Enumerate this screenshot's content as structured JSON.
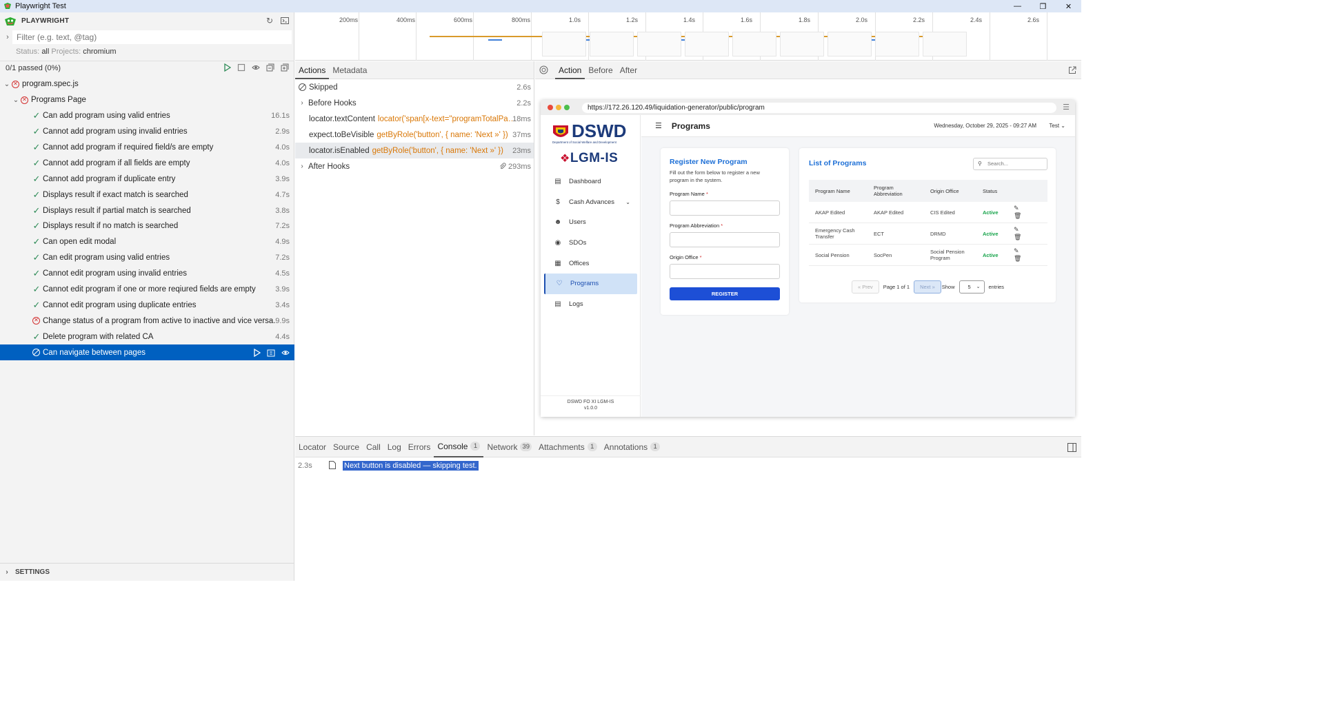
{
  "window": {
    "title": "Playwright Test",
    "controls": [
      "minimize-icon",
      "restore-icon",
      "close-icon"
    ]
  },
  "sidebar": {
    "brand": "PLAYWRIGHT",
    "filter_placeholder": "Filter (e.g. text, @tag)",
    "status_label": "Status:",
    "status_value": "all",
    "projects_label": "Projects:",
    "projects_value": "chromium",
    "summary": "0/1 passed (0%)",
    "file": "program.spec.js",
    "suite": "Programs Page",
    "tests": [
      {
        "name": "Can add program using valid entries",
        "duration": "16.1s",
        "status": "passed"
      },
      {
        "name": "Cannot add program using invalid entries",
        "duration": "2.9s",
        "status": "passed"
      },
      {
        "name": "Cannot add program if required field/s are empty",
        "duration": "4.0s",
        "status": "passed"
      },
      {
        "name": "Cannot add program if all fields are empty",
        "duration": "4.0s",
        "status": "passed"
      },
      {
        "name": "Cannot add program if duplicate entry",
        "duration": "3.9s",
        "status": "passed"
      },
      {
        "name": "Displays result if exact match is searched",
        "duration": "4.7s",
        "status": "passed"
      },
      {
        "name": "Displays result if partial match is searched",
        "duration": "3.8s",
        "status": "passed"
      },
      {
        "name": "Displays result if no match is searched",
        "duration": "7.2s",
        "status": "passed"
      },
      {
        "name": "Can open edit modal",
        "duration": "4.9s",
        "status": "passed"
      },
      {
        "name": "Can edit program using valid entries",
        "duration": "7.2s",
        "status": "passed"
      },
      {
        "name": "Cannot edit program using invalid entries",
        "duration": "4.5s",
        "status": "passed"
      },
      {
        "name": "Cannot edit program if one or more reqiured fields are empty",
        "duration": "3.9s",
        "status": "passed"
      },
      {
        "name": "Cannot edit program using duplicate entries",
        "duration": "3.4s",
        "status": "passed"
      },
      {
        "name": "Change status of a program from active to inactive and vice versa.",
        "duration": "9.9s",
        "status": "failed"
      },
      {
        "name": "Delete program with related CA",
        "duration": "4.4s",
        "status": "passed"
      },
      {
        "name": "Can navigate between pages",
        "duration": "",
        "status": "skipped"
      }
    ],
    "settings": "SETTINGS"
  },
  "timeline": {
    "ticks": [
      "200ms",
      "400ms",
      "600ms",
      "800ms",
      "1.0s",
      "1.2s",
      "1.4s",
      "1.6s",
      "1.8s",
      "2.0s",
      "2.2s",
      "2.4s",
      "2.6s"
    ]
  },
  "actions": {
    "tabs": [
      "Actions",
      "Metadata"
    ],
    "rows": [
      {
        "label": "Skipped",
        "locator": "",
        "duration": "2.6s"
      },
      {
        "label": "Before Hooks",
        "locator": "",
        "duration": "2.2s"
      },
      {
        "label": "locator.textContent",
        "locator": "locator('span[x-text=\"programTotalPages...",
        "duration": "18ms"
      },
      {
        "label": "expect.toBeVisible",
        "locator": "getByRole('button', { name: 'Next »' })",
        "duration": "37ms"
      },
      {
        "label": "locator.isEnabled",
        "locator": "getByRole('button', { name: 'Next »' })",
        "duration": "23ms"
      },
      {
        "label": "After Hooks",
        "locator": "",
        "duration": "293ms"
      }
    ]
  },
  "snapshot": {
    "tabs": [
      "Action",
      "Before",
      "After"
    ],
    "url": "https://172.26.120.49/liquidation-generator/public/program",
    "app": {
      "logo_text": "DSWD",
      "logo_sub": "Department of Social Welfare and Development",
      "system_name": "LGM-IS",
      "nav": [
        "Dashboard",
        "Cash Advances",
        "Users",
        "SDOs",
        "Offices",
        "Programs",
        "Logs"
      ],
      "footer_line1": "DSWD FO XI LGM-IS",
      "footer_line2": "v1.0.0",
      "page_title": "Programs",
      "date": "Wednesday, October 29, 2025 - 09:27 AM",
      "user": "Test",
      "form": {
        "title": "Register New Program",
        "subtitle": "Fill out the form below to register a new program in the system.",
        "field1": "Program Name",
        "field2": "Program Abbreviation",
        "field3": "Origin Office",
        "button": "REGISTER"
      },
      "list": {
        "title": "List of Programs",
        "search_placeholder": "Search...",
        "headers": [
          "Program Name",
          "Program Abbreviation",
          "Origin Office",
          "Status"
        ],
        "rows": [
          [
            "AKAP Edited",
            "AKAP Edited",
            "CIS Edited",
            "Active"
          ],
          [
            "Emergency Cash Transfer",
            "ECT",
            "DRMD",
            "Active"
          ],
          [
            "Social Pension",
            "SocPen",
            "Social Pension Program",
            "Active"
          ]
        ],
        "prev": "« Prev",
        "page_info": "Page 1 of 1",
        "next": "Next »",
        "show": "Show",
        "per_page": "5",
        "entries": "entries"
      }
    }
  },
  "bottom": {
    "tabs": [
      {
        "label": "Locator",
        "count": ""
      },
      {
        "label": "Source",
        "count": ""
      },
      {
        "label": "Call",
        "count": ""
      },
      {
        "label": "Log",
        "count": ""
      },
      {
        "label": "Errors",
        "count": ""
      },
      {
        "label": "Console",
        "count": "1"
      },
      {
        "label": "Network",
        "count": "39"
      },
      {
        "label": "Attachments",
        "count": "1"
      },
      {
        "label": "Annotations",
        "count": "1"
      }
    ],
    "console_time": "2.3s",
    "console_message": "Next button is disabled — skipping test."
  }
}
